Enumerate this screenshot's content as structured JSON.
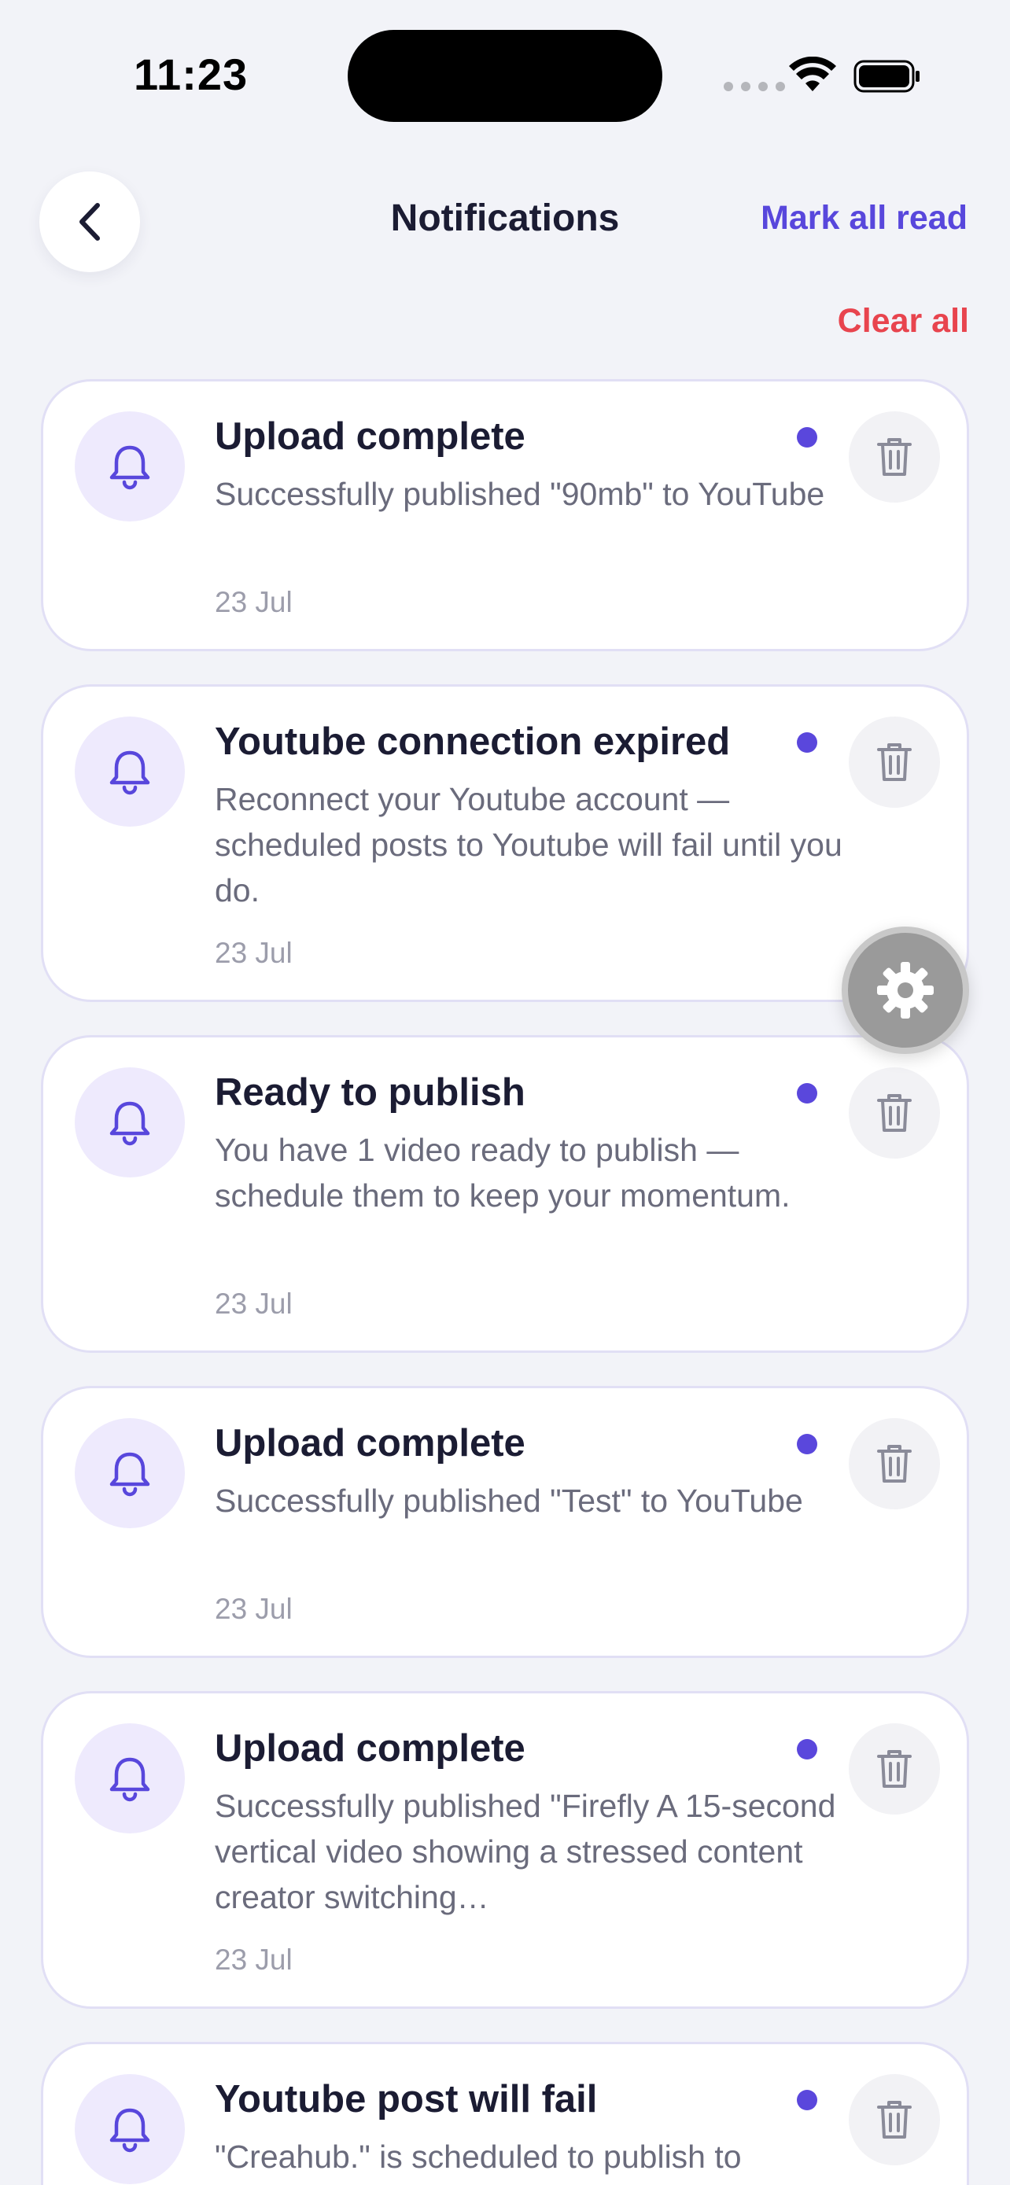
{
  "status_bar": {
    "time": "11:23"
  },
  "header": {
    "title": "Notifications",
    "mark_all_read": "Mark all read",
    "clear_all": "Clear all"
  },
  "notifications": [
    {
      "title": "Upload complete",
      "body": "Successfully published \"90mb\" to YouTube",
      "date": "23 Jul",
      "unread": true
    },
    {
      "title": "Youtube connection expired",
      "body": "Reconnect your Youtube account — scheduled posts to Youtube will fail until you do.",
      "date": "23 Jul",
      "unread": true
    },
    {
      "title": "Ready to publish",
      "body": "You have 1 video ready to publish — schedule them to keep your momentum.",
      "date": "23 Jul",
      "unread": true
    },
    {
      "title": "Upload complete",
      "body": "Successfully published \"Test\" to YouTube",
      "date": "23 Jul",
      "unread": true
    },
    {
      "title": "Upload complete",
      "body": "Successfully published \"Firefly A 15-second vertical video showing a stressed content creator switching…",
      "date": "23 Jul",
      "unread": true
    },
    {
      "title": "Youtube post will fail",
      "body": "\"Creahub.\" is scheduled to publish to",
      "date": "",
      "unread": true
    }
  ],
  "icons": {
    "back": "chevron-left-icon",
    "notification": "bell-icon",
    "delete": "trash-icon",
    "settings": "gear-icon"
  },
  "colors": {
    "accent": "#5847dc",
    "danger": "#e8444e",
    "background": "#f2f3f8",
    "icon_bg": "#eeeafd"
  }
}
